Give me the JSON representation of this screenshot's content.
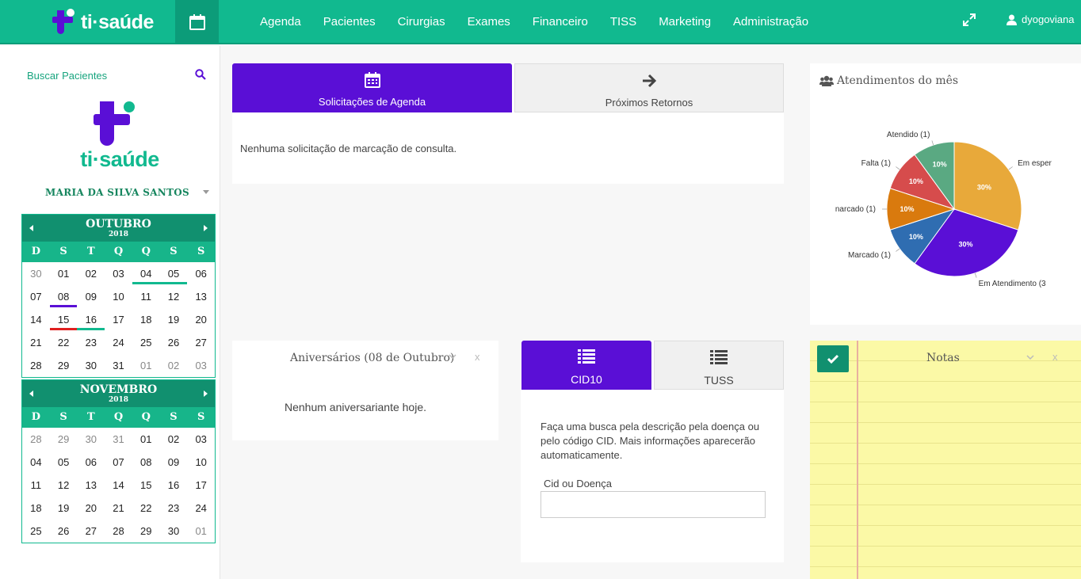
{
  "brand": {
    "name": "ti·saúde"
  },
  "nav": {
    "items": [
      "Agenda",
      "Pacientes",
      "Cirurgias",
      "Exames",
      "Financeiro",
      "TISS",
      "Marketing",
      "Administração"
    ],
    "user": "dyogoviana"
  },
  "sidebar": {
    "search_label": "Buscar Pacientes",
    "logo_text": "ti·saúde",
    "user_name": "MARIA DA SILVA SANTOS"
  },
  "calendars": [
    {
      "month": "OUTUBRO",
      "year": "2018",
      "dow": [
        "D",
        "S",
        "T",
        "Q",
        "Q",
        "S",
        "S"
      ],
      "weeks": [
        [
          "30",
          "01",
          "02",
          "03",
          "04",
          "05",
          "06"
        ],
        [
          "07",
          "08",
          "09",
          "10",
          "11",
          "12",
          "13"
        ],
        [
          "14",
          "15",
          "16",
          "17",
          "18",
          "19",
          "20"
        ],
        [
          "21",
          "22",
          "23",
          "24",
          "25",
          "26",
          "27"
        ],
        [
          "28",
          "29",
          "30",
          "31",
          "01",
          "02",
          "03"
        ]
      ]
    },
    {
      "month": "NOVEMBRO",
      "year": "2018",
      "dow": [
        "D",
        "S",
        "T",
        "Q",
        "Q",
        "S",
        "S"
      ],
      "weeks": [
        [
          "28",
          "29",
          "30",
          "31",
          "01",
          "02",
          "03"
        ],
        [
          "04",
          "05",
          "06",
          "07",
          "08",
          "09",
          "10"
        ],
        [
          "11",
          "12",
          "13",
          "14",
          "15",
          "16",
          "17"
        ],
        [
          "18",
          "19",
          "20",
          "21",
          "22",
          "23",
          "24"
        ],
        [
          "25",
          "26",
          "27",
          "28",
          "29",
          "30",
          "01"
        ]
      ]
    }
  ],
  "requests": {
    "tab_active": "Solicitações de Agenda",
    "tab_inactive": "Próximos Retornos",
    "empty": "Nenhuma solicitação de marcação de consulta."
  },
  "birthdays": {
    "title": "Aniversários (08 de Outubro)",
    "empty": "Nenhum aniversariante hoje.",
    "close": "x"
  },
  "cid": {
    "tab_active": "CID10",
    "tab_inactive": "TUSS",
    "description": "Faça uma busca pela descrição pela doença ou pelo código CID. Mais informações aparecerão automaticamente.",
    "label": "Cid ou Doença",
    "value": ""
  },
  "notes": {
    "title": "Notas",
    "close": "x"
  },
  "colors": {
    "primary": "#11b98f",
    "accent": "#5a0fd6"
  },
  "chart_data": {
    "type": "pie",
    "title": "Atendimentos do mês",
    "slices": [
      {
        "label": "Em esper",
        "value": 30,
        "pct": "30%",
        "color": "#e8a93a"
      },
      {
        "label": "Em Atendimento (3",
        "value": 30,
        "pct": "30%",
        "color": "#5a0fd6"
      },
      {
        "label": "Marcado (1)",
        "value": 10,
        "pct": "10%",
        "color": "#2f6db1"
      },
      {
        "label": "narcado (1)",
        "value": 10,
        "pct": "10%",
        "color": "#d97a0e"
      },
      {
        "label": "Falta (1)",
        "value": 10,
        "pct": "10%",
        "color": "#d64c4c"
      },
      {
        "label": "Atendido (1)",
        "value": 10,
        "pct": "10%",
        "color": "#5aa982"
      }
    ]
  }
}
